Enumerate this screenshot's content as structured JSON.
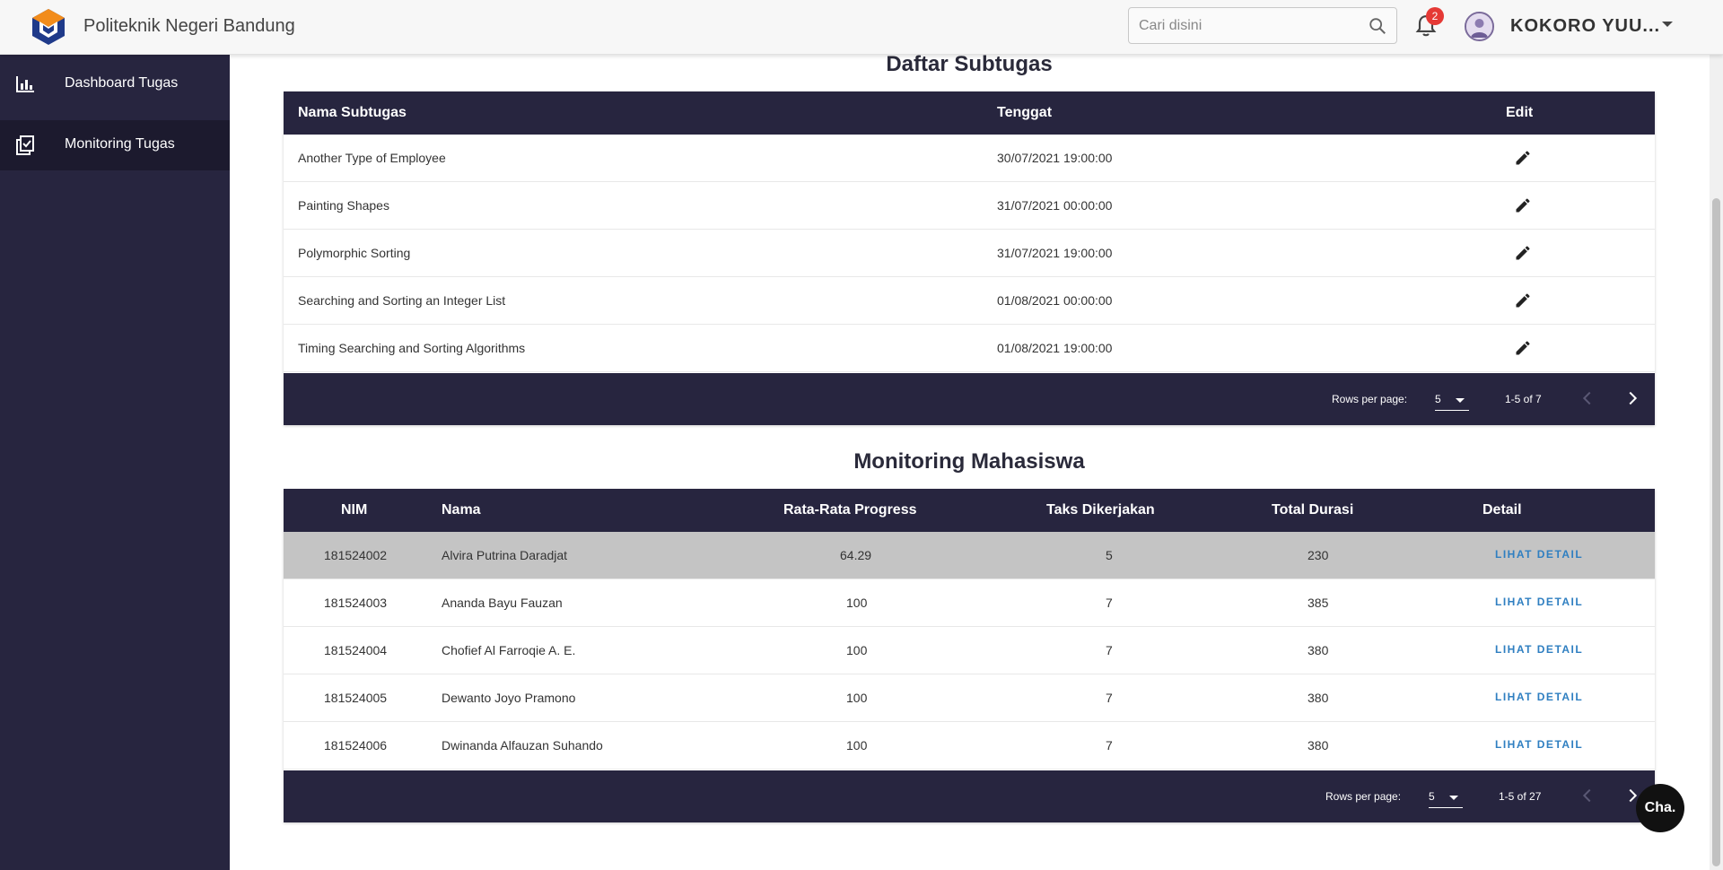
{
  "header": {
    "brand": "Politeknik Negeri Bandung",
    "search_placeholder": "Cari disini",
    "notification_count": "2",
    "username": "KOKORO YUU..."
  },
  "sidebar": {
    "items": [
      {
        "label": "Dashboard Tugas",
        "icon": "bar-chart-icon"
      },
      {
        "label": "Monitoring Tugas",
        "icon": "clipboard-check-icon"
      }
    ]
  },
  "subtugas": {
    "title": "Daftar Subtugas",
    "columns": [
      "Nama Subtugas",
      "Tenggat",
      "Edit"
    ],
    "rows": [
      {
        "nama": "Another Type of Employee",
        "tenggat": "30/07/2021 19:00:00"
      },
      {
        "nama": "Painting Shapes",
        "tenggat": "31/07/2021 00:00:00"
      },
      {
        "nama": "Polymorphic Sorting",
        "tenggat": "31/07/2021 19:00:00"
      },
      {
        "nama": "Searching and Sorting an Integer List",
        "tenggat": "01/08/2021 00:00:00"
      },
      {
        "nama": "Timing Searching and Sorting Algorithms",
        "tenggat": "01/08/2021 19:00:00"
      }
    ],
    "rows_per_page_label": "Rows per page:",
    "rows_per_page": "5",
    "range": "1-5 of 7"
  },
  "monitoring": {
    "title": "Monitoring Mahasiswa",
    "columns": [
      "NIM",
      "Nama",
      "Rata-Rata Progress",
      "Taks Dikerjakan",
      "Total Durasi",
      "Detail"
    ],
    "rows": [
      {
        "nim": "181524002",
        "nama": "Alvira Putrina Daradjat",
        "progress": "64.29",
        "taks": "5",
        "durasi": "230",
        "detail": "LIHAT DETAIL"
      },
      {
        "nim": "181524003",
        "nama": "Ananda Bayu Fauzan",
        "progress": "100",
        "taks": "7",
        "durasi": "385",
        "detail": "LIHAT DETAIL"
      },
      {
        "nim": "181524004",
        "nama": "Chofief Al Farroqie A. E.",
        "progress": "100",
        "taks": "7",
        "durasi": "380",
        "detail": "LIHAT DETAIL"
      },
      {
        "nim": "181524005",
        "nama": "Dewanto Joyo Pramono",
        "progress": "100",
        "taks": "7",
        "durasi": "380",
        "detail": "LIHAT DETAIL"
      },
      {
        "nim": "181524006",
        "nama": "Dwinanda Alfauzan Suhando",
        "progress": "100",
        "taks": "7",
        "durasi": "380",
        "detail": "LIHAT DETAIL"
      }
    ],
    "rows_per_page_label": "Rows per page:",
    "rows_per_page": "5",
    "range": "1-5 of 27"
  },
  "chat": {
    "label": "Cha."
  },
  "colors": {
    "sidebar": "#27253f",
    "table_header": "#27253f",
    "link": "#2f7fc1",
    "badge": "#e53935"
  }
}
